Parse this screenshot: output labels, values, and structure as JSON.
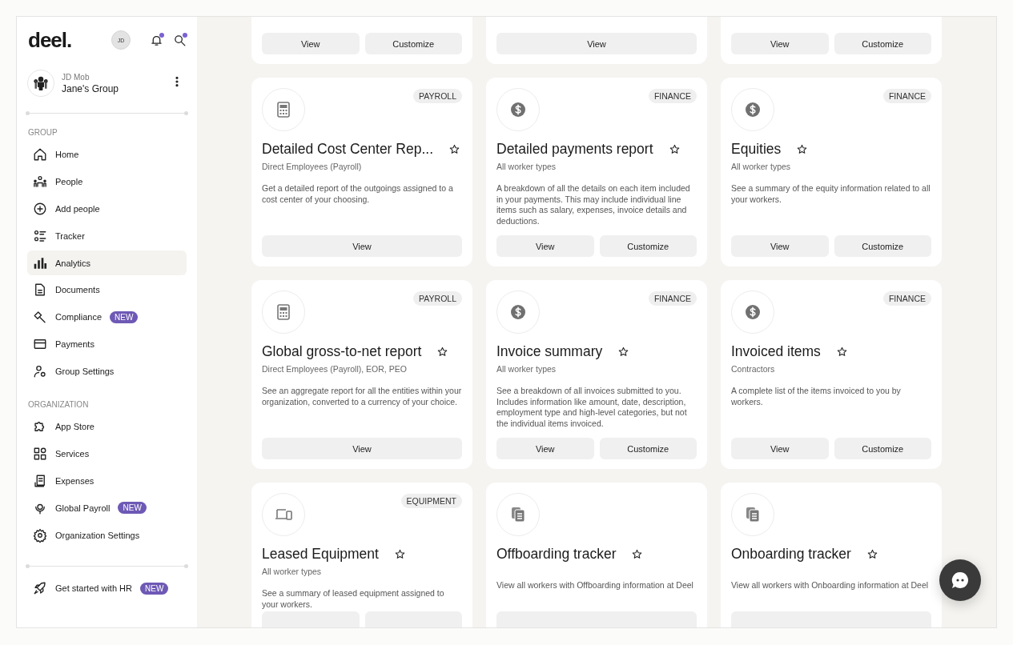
{
  "sidebar": {
    "logo": "deel.",
    "avatar": "JD",
    "notifications_dot": true,
    "search_dot": true,
    "account": {
      "org": "JD Mob",
      "group": "Jane's Group"
    },
    "sections": [
      {
        "title": "GROUP",
        "items": [
          {
            "label": "Home",
            "kind": "home",
            "selected": false
          },
          {
            "label": "People",
            "kind": "people",
            "selected": false
          },
          {
            "label": "Add people",
            "kind": "add",
            "selected": false
          },
          {
            "label": "Tracker",
            "kind": "tracker",
            "selected": false
          },
          {
            "label": "Analytics",
            "kind": "analytics",
            "selected": true
          },
          {
            "label": "Documents",
            "kind": "documents",
            "selected": false
          },
          {
            "label": "Compliance",
            "kind": "compliance",
            "selected": false,
            "badge": "NEW"
          },
          {
            "label": "Payments",
            "kind": "payments",
            "selected": false
          },
          {
            "label": "Group Settings",
            "kind": "group-settings",
            "selected": false
          }
        ]
      },
      {
        "title": "ORGANIZATION",
        "items": [
          {
            "label": "App Store",
            "kind": "app-store",
            "selected": false
          },
          {
            "label": "Services",
            "kind": "services",
            "selected": false
          },
          {
            "label": "Expenses",
            "kind": "expenses",
            "selected": false
          },
          {
            "label": "Global Payroll",
            "kind": "global-payroll",
            "selected": false,
            "badge": "NEW"
          },
          {
            "label": "Organization Settings",
            "kind": "org-settings",
            "selected": false
          }
        ]
      }
    ],
    "footer": {
      "label": "Get started with HR",
      "kind": "rocket",
      "badge": "NEW"
    }
  },
  "report_rows": [
    {
      "kind": "partial-top",
      "cards": [
        {
          "buttons": [
            {
              "label": "View"
            },
            {
              "label": "Customize"
            }
          ]
        },
        {
          "buttons": [
            {
              "label": "View"
            }
          ]
        },
        {
          "buttons": [
            {
              "label": "View"
            },
            {
              "label": "Customize"
            }
          ]
        }
      ]
    },
    {
      "kind": "full",
      "cards": [
        {
          "kind": "calculator",
          "tag": "PAYROLL",
          "title": "Detailed Cost Center Rep...",
          "subtitle": "Direct Employees (Payroll)",
          "description": "Get a detailed report of the outgoings assigned to a cost center of your choosing.",
          "buttons": [
            {
              "label": "View"
            }
          ]
        },
        {
          "kind": "dollar",
          "tag": "FINANCE",
          "title": "Detailed payments report",
          "subtitle": "All worker types",
          "description": "A breakdown of all the details on each item included in your payments. This may include individual line items such as salary, expenses, invoice details and deductions.",
          "buttons": [
            {
              "label": "View"
            },
            {
              "label": "Customize"
            }
          ]
        },
        {
          "kind": "dollar",
          "tag": "FINANCE",
          "title": "Equities",
          "subtitle": "All worker types",
          "description": "See a summary of the equity information related to all your workers.",
          "buttons": [
            {
              "label": "View"
            },
            {
              "label": "Customize"
            }
          ]
        }
      ]
    },
    {
      "kind": "full",
      "cards": [
        {
          "kind": "calculator",
          "tag": "PAYROLL",
          "title": "Global gross-to-net report",
          "subtitle": "Direct Employees (Payroll), EOR, PEO",
          "description": "See an aggregate report for all the entities within your organization, converted to a currency of your choice.",
          "buttons": [
            {
              "label": "View"
            }
          ]
        },
        {
          "kind": "dollar",
          "tag": "FINANCE",
          "title": "Invoice summary",
          "subtitle": "All worker types",
          "description": "See a breakdown of all invoices submitted to you. Includes information like amount, date, description, employment type and high-level categories, but not the individual items invoiced.",
          "buttons": [
            {
              "label": "View"
            },
            {
              "label": "Customize"
            }
          ]
        },
        {
          "kind": "dollar",
          "tag": "FINANCE",
          "title": "Invoiced items",
          "subtitle": "Contractors",
          "description": "A complete list of the items invoiced to you by workers.",
          "buttons": [
            {
              "label": "View"
            },
            {
              "label": "Customize"
            }
          ]
        }
      ]
    },
    {
      "kind": "partial-bottom",
      "cards": [
        {
          "kind": "devices",
          "tag": "EQUIPMENT",
          "title": "Leased Equipment",
          "subtitle": "All worker types",
          "description": "See a summary of leased equipment assigned to your workers.",
          "buttons": [
            {
              "kind": "cut"
            },
            {
              "kind": "cut"
            }
          ]
        },
        {
          "kind": "docs",
          "title": "Offboarding tracker",
          "description": "View all workers with Offboarding information at Deel",
          "buttons": [
            {
              "kind": "cut"
            }
          ]
        },
        {
          "kind": "docs",
          "title": "Onboarding tracker",
          "description": "View all workers with Onboarding information at Deel",
          "buttons": [
            {
              "kind": "cut"
            }
          ]
        }
      ]
    }
  ]
}
